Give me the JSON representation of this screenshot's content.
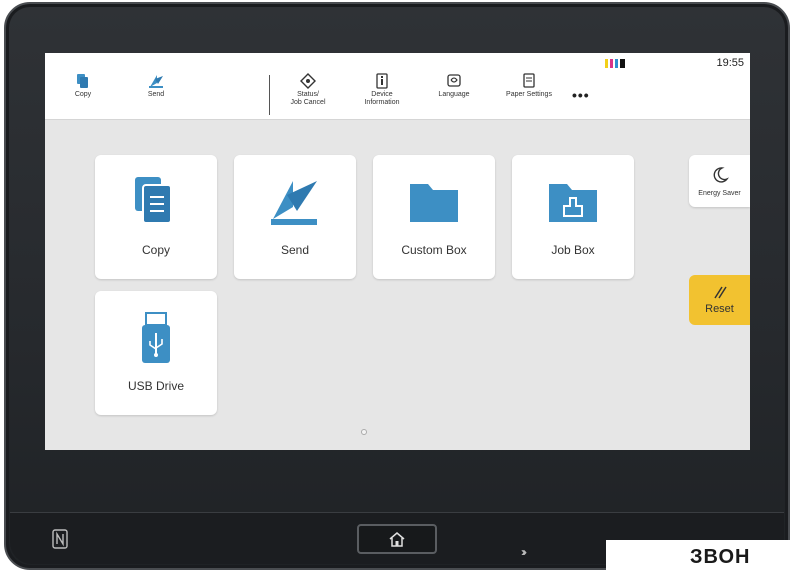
{
  "status_bar": {
    "time": "19:55",
    "toner_colors": [
      "#f2d01a",
      "#d7358a",
      "#2e8fd1",
      "#111111"
    ]
  },
  "header_items": [
    {
      "label": "Copy",
      "icon": "copy-icon"
    },
    {
      "label": "Send",
      "icon": "send-icon"
    },
    {
      "label": "Status/\nJob Cancel",
      "icon": "status-icon"
    },
    {
      "label": "Device\nInformation",
      "icon": "device-info-icon"
    },
    {
      "label": "Language",
      "icon": "language-icon"
    },
    {
      "label": "Paper Settings",
      "icon": "paper-settings-icon"
    }
  ],
  "more_label": "•••",
  "tiles": [
    {
      "label": "Copy",
      "icon": "copy-icon"
    },
    {
      "label": "Send",
      "icon": "send-icon"
    },
    {
      "label": "Custom Box",
      "icon": "folder-icon"
    },
    {
      "label": "Job Box",
      "icon": "job-box-icon"
    },
    {
      "label": "USB Drive",
      "icon": "usb-drive-icon"
    }
  ],
  "energy_saver": {
    "label": "Energy Saver",
    "icon": "moon-icon"
  },
  "reset": {
    "label": "Reset",
    "icon": "reset-slash-icon"
  },
  "hardware": {
    "home_icon": "home-icon",
    "nfc_icon": "nfc-icon"
  },
  "watermark": {
    "text_a": "ЗВОН",
    "text_b": ""
  },
  "colors": {
    "accent": "#3d8fc4",
    "reset_bg": "#f2c230",
    "screen_bg": "#e6e6e6"
  }
}
